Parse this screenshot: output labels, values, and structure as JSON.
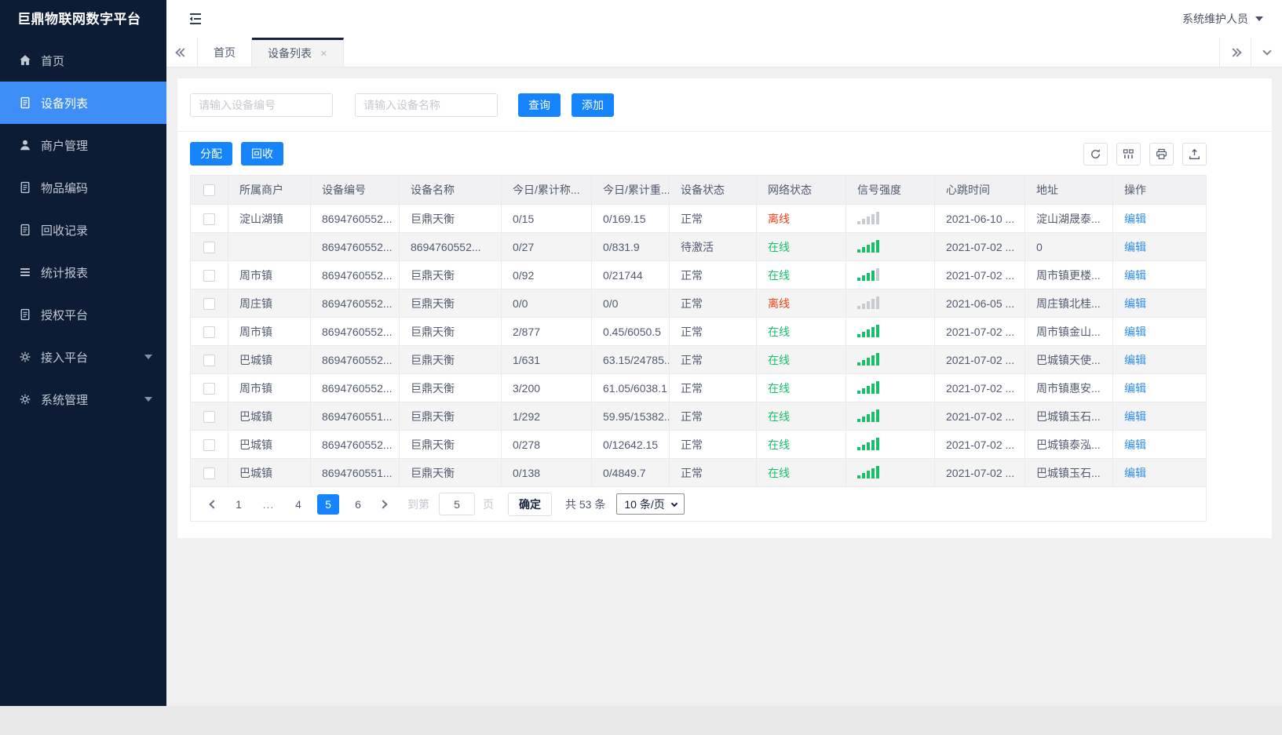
{
  "app": {
    "title": "巨鼎物联网数字平台",
    "user": "系统维护人员"
  },
  "sidebar": {
    "items": [
      {
        "label": "首页",
        "icon": "home",
        "active": false,
        "expandable": false
      },
      {
        "label": "设备列表",
        "icon": "doc",
        "active": true,
        "expandable": false
      },
      {
        "label": "商户管理",
        "icon": "user",
        "active": false,
        "expandable": false
      },
      {
        "label": "物品编码",
        "icon": "doc",
        "active": false,
        "expandable": false
      },
      {
        "label": "回收记录",
        "icon": "doc",
        "active": false,
        "expandable": false
      },
      {
        "label": "统计报表",
        "icon": "lines",
        "active": false,
        "expandable": false
      },
      {
        "label": "授权平台",
        "icon": "doc",
        "active": false,
        "expandable": false
      },
      {
        "label": "接入平台",
        "icon": "gear",
        "active": false,
        "expandable": true
      },
      {
        "label": "系统管理",
        "icon": "gear",
        "active": false,
        "expandable": true
      }
    ]
  },
  "tabs": {
    "items": [
      {
        "label": "首页",
        "active": false,
        "closable": false
      },
      {
        "label": "设备列表",
        "active": true,
        "closable": true
      }
    ],
    "close_icon": "×"
  },
  "search": {
    "device_no_placeholder": "请输入设备编号",
    "device_name_placeholder": "请输入设备名称",
    "query_label": "查询",
    "add_label": "添加"
  },
  "toolbar": {
    "assign_label": "分配",
    "recycle_label": "回收",
    "icons": [
      "refresh",
      "columns",
      "print",
      "export"
    ]
  },
  "table": {
    "columns": [
      "所属商户",
      "设备编号",
      "设备名称",
      "今日/累计称...",
      "今日/累计重...",
      "设备状态",
      "网络状态",
      "信号强度",
      "心跳时间",
      "地址",
      "操作"
    ],
    "edit_label": "编辑",
    "rows": [
      {
        "merchant": "淀山湖镇",
        "device_no": "8694760552...",
        "device_name": "巨鼎天衡",
        "today_count": "0/15",
        "today_weight": "0/169.15",
        "status": "正常",
        "network": "离线",
        "network_state": "offline",
        "signal": 0,
        "heartbeat": "2021-06-10 ...",
        "address": "淀山湖晟泰..."
      },
      {
        "merchant": "",
        "device_no": "8694760552...",
        "device_name": "8694760552...",
        "today_count": "0/27",
        "today_weight": "0/831.9",
        "status": "待激活",
        "network": "在线",
        "network_state": "online",
        "signal": 5,
        "heartbeat": "2021-07-02 ...",
        "address": "0"
      },
      {
        "merchant": "周市镇",
        "device_no": "8694760552...",
        "device_name": "巨鼎天衡",
        "today_count": "0/92",
        "today_weight": "0/21744",
        "status": "正常",
        "network": "在线",
        "network_state": "online",
        "signal": 4,
        "heartbeat": "2021-07-02 ...",
        "address": "周市镇更楼..."
      },
      {
        "merchant": "周庄镇",
        "device_no": "8694760552...",
        "device_name": "巨鼎天衡",
        "today_count": "0/0",
        "today_weight": "0/0",
        "status": "正常",
        "network": "离线",
        "network_state": "offline",
        "signal": 0,
        "heartbeat": "2021-06-05 ...",
        "address": "周庄镇北桂..."
      },
      {
        "merchant": "周市镇",
        "device_no": "8694760552...",
        "device_name": "巨鼎天衡",
        "today_count": "2/877",
        "today_weight": "0.45/6050.5",
        "status": "正常",
        "network": "在线",
        "network_state": "online",
        "signal": 5,
        "heartbeat": "2021-07-02 ...",
        "address": "周市镇金山..."
      },
      {
        "merchant": "巴城镇",
        "device_no": "8694760552...",
        "device_name": "巨鼎天衡",
        "today_count": "1/631",
        "today_weight": "63.15/24785...",
        "status": "正常",
        "network": "在线",
        "network_state": "online",
        "signal": 5,
        "heartbeat": "2021-07-02 ...",
        "address": "巴城镇天使..."
      },
      {
        "merchant": "周市镇",
        "device_no": "8694760552...",
        "device_name": "巨鼎天衡",
        "today_count": "3/200",
        "today_weight": "61.05/6038.1",
        "status": "正常",
        "network": "在线",
        "network_state": "online",
        "signal": 5,
        "heartbeat": "2021-07-02 ...",
        "address": "周市镇惠安..."
      },
      {
        "merchant": "巴城镇",
        "device_no": "8694760551...",
        "device_name": "巨鼎天衡",
        "today_count": "1/292",
        "today_weight": "59.95/15382...",
        "status": "正常",
        "network": "在线",
        "network_state": "online",
        "signal": 5,
        "heartbeat": "2021-07-02 ...",
        "address": "巴城镇玉石..."
      },
      {
        "merchant": "巴城镇",
        "device_no": "8694760552...",
        "device_name": "巨鼎天衡",
        "today_count": "0/278",
        "today_weight": "0/12642.15",
        "status": "正常",
        "network": "在线",
        "network_state": "online",
        "signal": 5,
        "heartbeat": "2021-07-02 ...",
        "address": "巴城镇泰泓..."
      },
      {
        "merchant": "巴城镇",
        "device_no": "8694760551...",
        "device_name": "巨鼎天衡",
        "today_count": "0/138",
        "today_weight": "0/4849.7",
        "status": "正常",
        "network": "在线",
        "network_state": "online",
        "signal": 5,
        "heartbeat": "2021-07-02 ...",
        "address": "巴城镇玉石..."
      }
    ]
  },
  "pagination": {
    "pages": [
      {
        "label": "1",
        "active": false
      },
      {
        "label": "...",
        "active": false,
        "ellipsis": true
      },
      {
        "label": "4",
        "active": false
      },
      {
        "label": "5",
        "active": true
      },
      {
        "label": "6",
        "active": false
      }
    ],
    "goto_label": "到第",
    "goto_value": "5",
    "page_unit": "页",
    "confirm_label": "确定",
    "total_label": "共 53 条",
    "page_size": "10 条/页"
  },
  "colors": {
    "accent_blue": "#1684fc",
    "sidebar_bg": "#0c1c34",
    "active_item_blue": "#3e8ef7",
    "online_green": "#19be6b",
    "offline_red": "#ed4014",
    "link_blue": "#2d8cf0"
  }
}
